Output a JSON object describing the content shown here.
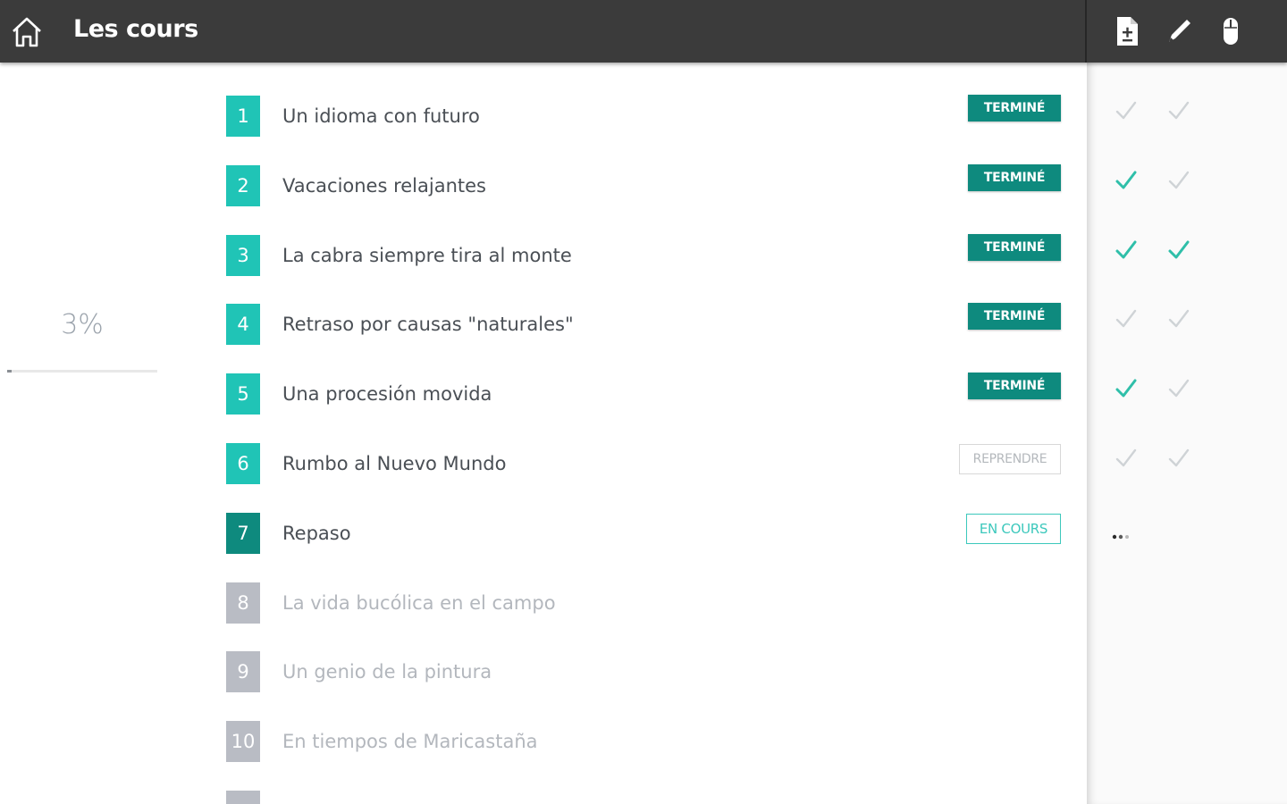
{
  "header": {
    "title": "Les cours",
    "home_icon": "home-icon",
    "tools": [
      "document-icon",
      "pencil-icon",
      "mouse-icon"
    ]
  },
  "progress": {
    "percent_label": "3%",
    "value": 0.03
  },
  "colors": {
    "accent_teal": "#20c4b6",
    "done_badge": "#0e8a7e",
    "current_teal": "#3cc8bc",
    "locked_grey": "#b9bcc4",
    "check_active": "#2fbfa9",
    "check_inactive": "#cfd3d6"
  },
  "lessons": [
    {
      "number": "1",
      "title": "Un idioma con futuro",
      "state": "done",
      "badge": "TERMINÉ",
      "checks": [
        false,
        false
      ]
    },
    {
      "number": "2",
      "title": "Vacaciones relajantes",
      "state": "done",
      "badge": "TERMINÉ",
      "checks": [
        true,
        false
      ]
    },
    {
      "number": "3",
      "title": "La cabra siempre tira al monte",
      "state": "done",
      "badge": "TERMINÉ",
      "checks": [
        true,
        true
      ]
    },
    {
      "number": "4",
      "title": "Retraso por causas \"naturales\"",
      "state": "done",
      "badge": "TERMINÉ",
      "checks": [
        false,
        false
      ]
    },
    {
      "number": "5",
      "title": "Una procesión movida",
      "state": "done",
      "badge": "TERMINÉ",
      "checks": [
        true,
        false
      ]
    },
    {
      "number": "6",
      "title": "Rumbo al Nuevo Mundo",
      "state": "resume",
      "badge": "REPRENDRE",
      "checks": [
        false,
        false
      ]
    },
    {
      "number": "7",
      "title": "Repaso",
      "state": "current",
      "badge": "EN COURS",
      "checks": null
    },
    {
      "number": "8",
      "title": "La vida bucólica en el campo",
      "state": "locked",
      "badge": "",
      "checks": null
    },
    {
      "number": "9",
      "title": "Un genio de la pintura",
      "state": "locked",
      "badge": "",
      "checks": null
    },
    {
      "number": "10",
      "title": "En tiempos de Maricastaña",
      "state": "locked",
      "badge": "",
      "checks": null
    }
  ]
}
